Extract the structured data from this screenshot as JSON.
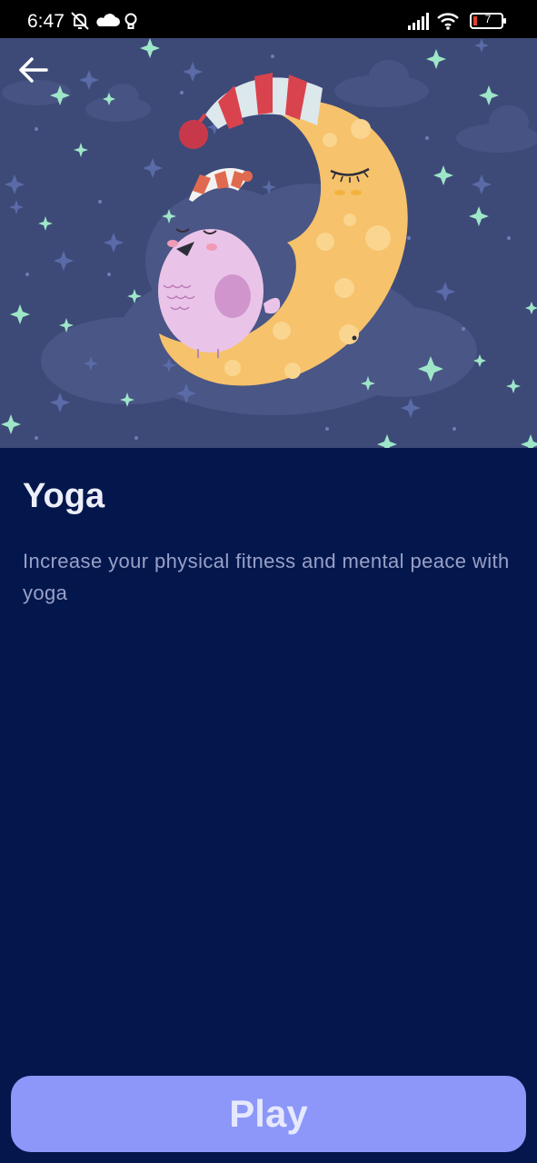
{
  "status_bar": {
    "time": "6:47",
    "battery_level": "7",
    "icons": [
      "muted-bell-icon",
      "cloud-icon",
      "lightbulb-icon",
      "signal-bars-icon",
      "wifi-icon",
      "battery-icon"
    ]
  },
  "header": {
    "back_icon": "arrow-left-icon"
  },
  "hero_image": {
    "subject": "sleeping-moon-and-bird-illustration"
  },
  "content": {
    "title": "Yoga",
    "description": "Increase your physical fitness and mental peace with yoga"
  },
  "actions": {
    "play_label": "Play"
  },
  "colors": {
    "background": "#03174D",
    "hero_background": "#3D4A78",
    "play_button": "#8C97F9",
    "title_text": "#ECEFF8",
    "description_text": "#98A1C7"
  }
}
